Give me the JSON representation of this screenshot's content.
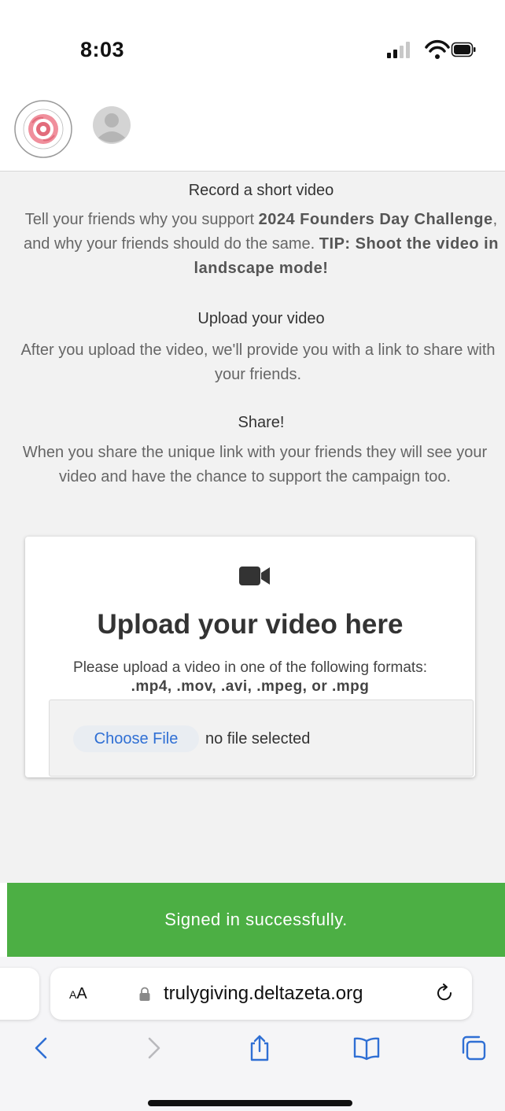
{
  "status_bar": {
    "time": "8:03"
  },
  "header": {
    "logo_alt": "Founders Day Challenge - Empower the Women"
  },
  "steps": [
    {
      "title": "Record a short video"
    },
    {
      "title": "Upload your video",
      "body": "After you upload the video, we'll provide you with a link to share with your friends."
    },
    {
      "title": "Share!",
      "body": "When you share the unique link with your friends they will see your video and have the chance to support the campaign too."
    }
  ],
  "step1_body": {
    "part1": "Tell your friends why you support ",
    "bold1": "2024 Founders Day Challenge",
    "part2": ", and why your friends should do the same. ",
    "bold2": "TIP: Shoot the video in landscape mode!"
  },
  "upload": {
    "title": "Upload your video here",
    "description": "Please upload a video in one of the following formats:",
    "formats": ".mp4, .mov, .avi, .mpeg, or .mpg",
    "choose_label": "Choose File",
    "no_file": "no file selected"
  },
  "toast": {
    "message": "Signed in successfully."
  },
  "browser": {
    "aa_label": "AA",
    "url": "trulygiving.deltazeta.org"
  },
  "colors": {
    "toast_green": "#4caf44",
    "link_blue": "#2f6fd4",
    "accent_rose": "#e26b7b"
  },
  "icons": [
    "signal-icon",
    "wifi-icon",
    "battery-icon",
    "video-camera-icon",
    "lock-icon",
    "reload-icon",
    "back-icon",
    "forward-icon",
    "share-icon",
    "bookmarks-icon",
    "tabs-icon"
  ]
}
